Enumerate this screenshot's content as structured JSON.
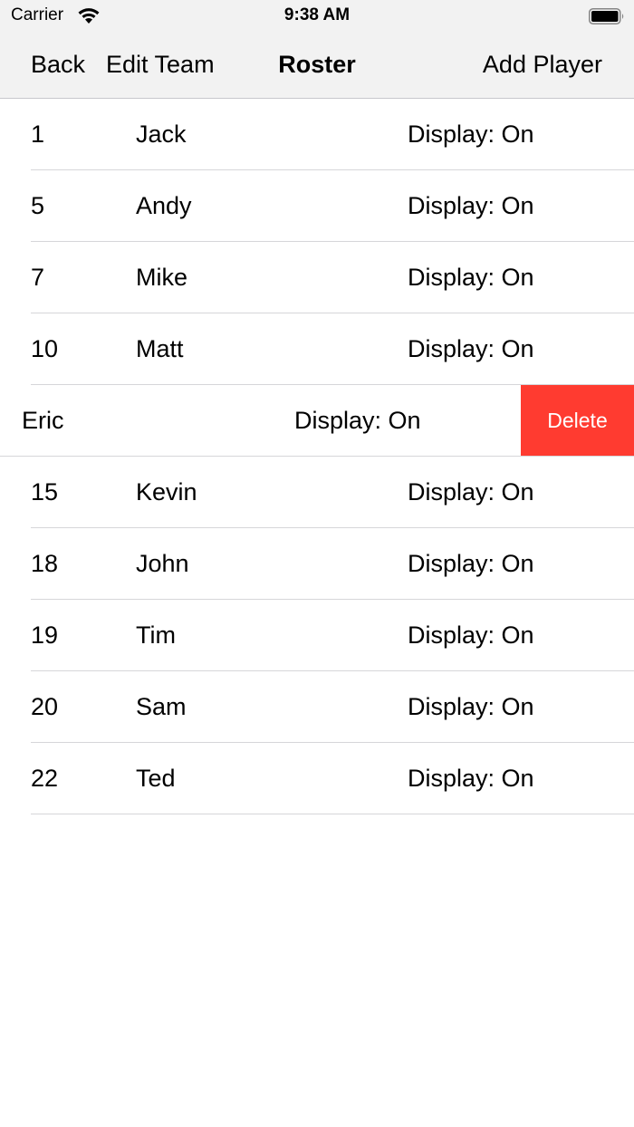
{
  "status_bar": {
    "carrier": "Carrier",
    "time": "9:38 AM",
    "wifi_icon": "wifi-icon",
    "battery_icon": "battery-icon"
  },
  "nav": {
    "back_label": "Back",
    "edit_label": "Edit Team",
    "title": "Roster",
    "add_label": "Add Player"
  },
  "roster": [
    {
      "number": "1",
      "name": "Jack",
      "display": "Display: On"
    },
    {
      "number": "5",
      "name": "Andy",
      "display": "Display: On"
    },
    {
      "number": "7",
      "name": "Mike",
      "display": "Display: On"
    },
    {
      "number": "10",
      "name": "Matt",
      "display": "Display: On"
    },
    {
      "number": "",
      "name": "Eric",
      "display": "Display: On",
      "delete_label": "Delete"
    },
    {
      "number": "15",
      "name": "Kevin",
      "display": "Display: On"
    },
    {
      "number": "18",
      "name": "John",
      "display": "Display: On"
    },
    {
      "number": "19",
      "name": "Tim",
      "display": "Display: On"
    },
    {
      "number": "20",
      "name": "Sam",
      "display": "Display: On"
    },
    {
      "number": "22",
      "name": "Ted",
      "display": "Display: On"
    }
  ],
  "colors": {
    "bar_background": "#f2f2f2",
    "delete": "#ff3b30",
    "separator": "#d6d6d9"
  }
}
